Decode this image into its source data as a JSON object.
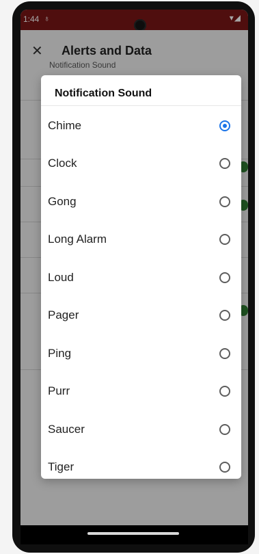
{
  "status_bar": {
    "time": "1:44",
    "extra_icon": "notification-icon",
    "right_icons": "▾◢"
  },
  "app_bar": {
    "title": "Alerts and Data",
    "close_icon": "✕"
  },
  "background": {
    "subtitle": "Notification Sound"
  },
  "dialog": {
    "title": "Notification Sound",
    "selected_index": 0,
    "options": [
      {
        "label": "Chime",
        "selected": true
      },
      {
        "label": "Clock",
        "selected": false
      },
      {
        "label": "Gong",
        "selected": false
      },
      {
        "label": "Long Alarm",
        "selected": false
      },
      {
        "label": "Loud",
        "selected": false
      },
      {
        "label": "Pager",
        "selected": false
      },
      {
        "label": "Ping",
        "selected": false
      },
      {
        "label": "Purr",
        "selected": false
      },
      {
        "label": "Saucer",
        "selected": false
      },
      {
        "label": "Tiger",
        "selected": false
      }
    ]
  },
  "colors": {
    "status_bar": "#7a1616",
    "radio_selected": "#1a73e8",
    "toggle_on": "#2e7d32"
  }
}
